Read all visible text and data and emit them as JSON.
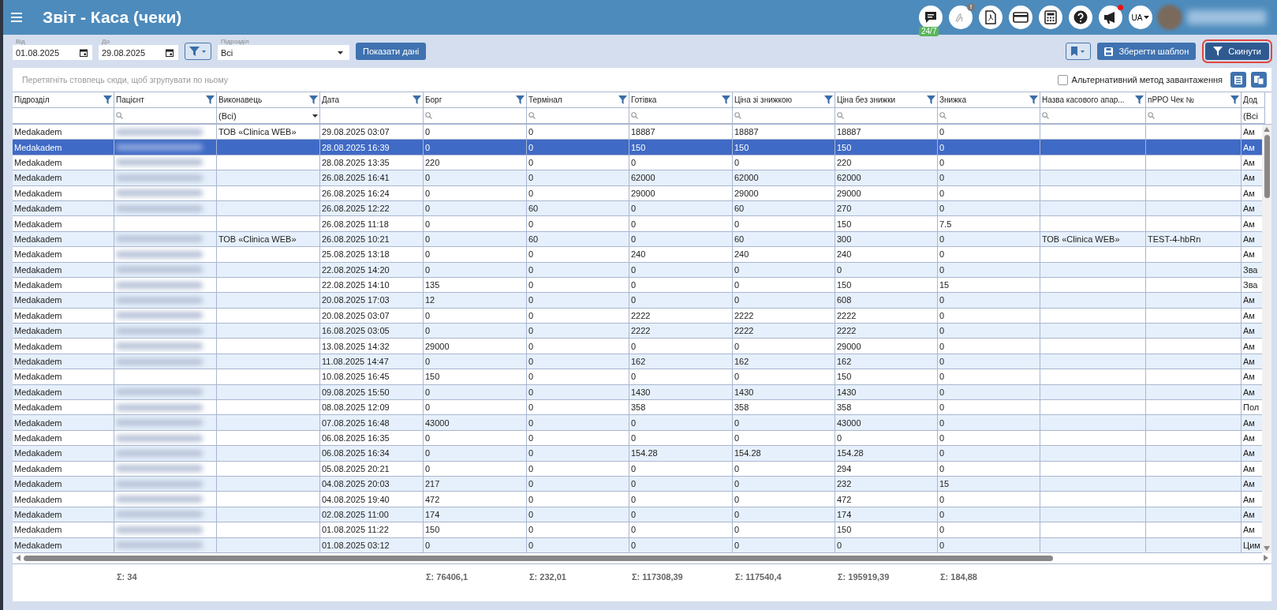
{
  "window": {
    "title": "Звіт - Каса (чеки)"
  },
  "header_icons": {
    "chat_badge": "24/7",
    "alert_badge": "!",
    "language": "UA"
  },
  "toolbar": {
    "date_from": {
      "label": "Від",
      "value": "01.08.2025"
    },
    "date_to": {
      "label": "До",
      "value": "29.08.2025"
    },
    "division": {
      "label": "Підрозділ",
      "value": "Всі"
    },
    "show_button": "Показати дані",
    "save_button": "Зберегти шаблон",
    "reset_button": "Скинути",
    "reset_highlighted": true
  },
  "group_panel": {
    "placeholder": "Перетягніть стовпець сюди, щоб згрупувати по ньому",
    "alt_load": {
      "label": "Альтернативний метод завантаження",
      "checked": false
    }
  },
  "table": {
    "columns": [
      {
        "label": "Підрозділ",
        "filter_button": true,
        "filter": {
          "kind": "none"
        }
      },
      {
        "label": "Пацієнт",
        "filter_button": true,
        "filter": {
          "kind": "search"
        }
      },
      {
        "label": "Виконавець",
        "filter_button": true,
        "filter": {
          "kind": "dropdown",
          "value": "(Всі)"
        }
      },
      {
        "label": "Дата",
        "filter_button": true,
        "filter": {
          "kind": "none"
        }
      },
      {
        "label": "Борг",
        "filter_button": true,
        "filter": {
          "kind": "search"
        }
      },
      {
        "label": "Термінал",
        "filter_button": true,
        "filter": {
          "kind": "search"
        }
      },
      {
        "label": "Готівка",
        "filter_button": true,
        "filter": {
          "kind": "search"
        }
      },
      {
        "label": "Ціна зі знижкою",
        "filter_button": true,
        "filter": {
          "kind": "search"
        }
      },
      {
        "label": "Ціна без знижки",
        "filter_button": true,
        "filter": {
          "kind": "search"
        }
      },
      {
        "label": "Знижка",
        "filter_button": true,
        "filter": {
          "kind": "search"
        }
      },
      {
        "label": "Назва касового апар...",
        "filter_button": true,
        "filter": {
          "kind": "search"
        }
      },
      {
        "label": "пРРО Чек №",
        "filter_button": true,
        "filter": {
          "kind": "search"
        }
      },
      {
        "label": "Дод",
        "filter_button": false,
        "filter": {
          "kind": "text",
          "value": "(Всі"
        }
      }
    ],
    "rows": [
      {
        "selected": false,
        "patient_blurred": true,
        "cells": [
          "Medakadem",
          null,
          "ТОВ «Clinica WEB»",
          "29.08.2025 03:07",
          "0",
          "0",
          "18887",
          "18887",
          "18887",
          "0",
          null,
          null,
          "Ам"
        ]
      },
      {
        "selected": true,
        "patient_blurred": true,
        "cells": [
          "Medakadem",
          null,
          null,
          "28.08.2025 16:39",
          "0",
          "0",
          "150",
          "150",
          "150",
          "0",
          null,
          null,
          "Ам"
        ]
      },
      {
        "selected": false,
        "patient_blurred": true,
        "cells": [
          "Medakadem",
          null,
          null,
          "28.08.2025 13:35",
          "220",
          "0",
          "0",
          "0",
          "220",
          "0",
          null,
          null,
          "Ам"
        ]
      },
      {
        "selected": false,
        "patient_blurred": true,
        "cells": [
          "Medakadem",
          null,
          null,
          "26.08.2025 16:41",
          "0",
          "0",
          "62000",
          "62000",
          "62000",
          "0",
          null,
          null,
          "Ам"
        ]
      },
      {
        "selected": false,
        "patient_blurred": true,
        "cells": [
          "Medakadem",
          null,
          null,
          "26.08.2025 16:24",
          "0",
          "0",
          "29000",
          "29000",
          "29000",
          "0",
          null,
          null,
          "Ам"
        ]
      },
      {
        "selected": false,
        "patient_blurred": true,
        "cells": [
          "Medakadem",
          null,
          null,
          "26.08.2025 12:22",
          "0",
          "60",
          "0",
          "60",
          "270",
          "0",
          null,
          null,
          "Ам"
        ]
      },
      {
        "selected": false,
        "patient_blurred": false,
        "cells": [
          "Medakadem",
          null,
          null,
          "26.08.2025 11:18",
          "0",
          "0",
          "0",
          "0",
          "150",
          "7.5",
          null,
          null,
          "Ам"
        ]
      },
      {
        "selected": false,
        "patient_blurred": true,
        "cells": [
          "Medakadem",
          null,
          "ТОВ «Clinica WEB»",
          "26.08.2025 10:21",
          "0",
          "60",
          "0",
          "60",
          "300",
          "0",
          "ТОВ «Clinica WEB»",
          "TEST-4-hbRn",
          "Ам"
        ]
      },
      {
        "selected": false,
        "patient_blurred": true,
        "cells": [
          "Medakadem",
          null,
          null,
          "25.08.2025 13:18",
          "0",
          "0",
          "240",
          "240",
          "240",
          "0",
          null,
          null,
          "Ам"
        ]
      },
      {
        "selected": false,
        "patient_blurred": true,
        "cells": [
          "Medakadem",
          null,
          null,
          "22.08.2025 14:20",
          "0",
          "0",
          "0",
          "0",
          "0",
          "0",
          null,
          null,
          "Зва"
        ]
      },
      {
        "selected": false,
        "patient_blurred": true,
        "cells": [
          "Medakadem",
          null,
          null,
          "22.08.2025 14:10",
          "135",
          "0",
          "0",
          "0",
          "150",
          "15",
          null,
          null,
          "Зва"
        ]
      },
      {
        "selected": false,
        "patient_blurred": true,
        "cells": [
          "Medakadem",
          null,
          null,
          "20.08.2025 17:03",
          "12",
          "0",
          "0",
          "0",
          "608",
          "0",
          null,
          null,
          "Ам"
        ]
      },
      {
        "selected": false,
        "patient_blurred": true,
        "cells": [
          "Medakadem",
          null,
          null,
          "20.08.2025 03:07",
          "0",
          "0",
          "2222",
          "2222",
          "2222",
          "0",
          null,
          null,
          "Ам"
        ]
      },
      {
        "selected": false,
        "patient_blurred": true,
        "cells": [
          "Medakadem",
          null,
          null,
          "16.08.2025 03:05",
          "0",
          "0",
          "2222",
          "2222",
          "2222",
          "0",
          null,
          null,
          "Ам"
        ]
      },
      {
        "selected": false,
        "patient_blurred": true,
        "cells": [
          "Medakadem",
          null,
          null,
          "13.08.2025 14:32",
          "29000",
          "0",
          "0",
          "0",
          "29000",
          "0",
          null,
          null,
          "Ам"
        ]
      },
      {
        "selected": false,
        "patient_blurred": true,
        "cells": [
          "Medakadem",
          null,
          null,
          "11.08.2025 14:47",
          "0",
          "0",
          "162",
          "162",
          "162",
          "0",
          null,
          null,
          "Ам"
        ]
      },
      {
        "selected": false,
        "patient_blurred": false,
        "cells": [
          "Medakadem",
          null,
          null,
          "10.08.2025 16:45",
          "150",
          "0",
          "0",
          "0",
          "150",
          "0",
          null,
          null,
          "Ам"
        ]
      },
      {
        "selected": false,
        "patient_blurred": true,
        "cells": [
          "Medakadem",
          null,
          null,
          "09.08.2025 15:50",
          "0",
          "0",
          "1430",
          "1430",
          "1430",
          "0",
          null,
          null,
          "Ам"
        ]
      },
      {
        "selected": false,
        "patient_blurred": true,
        "cells": [
          "Medakadem",
          null,
          null,
          "08.08.2025 12:09",
          "0",
          "0",
          "358",
          "358",
          "358",
          "0",
          null,
          null,
          "Пол"
        ]
      },
      {
        "selected": false,
        "patient_blurred": true,
        "cells": [
          "Medakadem",
          null,
          null,
          "07.08.2025 16:48",
          "43000",
          "0",
          "0",
          "0",
          "43000",
          "0",
          null,
          null,
          "Ам"
        ]
      },
      {
        "selected": false,
        "patient_blurred": true,
        "cells": [
          "Medakadem",
          null,
          null,
          "06.08.2025 16:35",
          "0",
          "0",
          "0",
          "0",
          "0",
          "0",
          null,
          null,
          "Ам"
        ]
      },
      {
        "selected": false,
        "patient_blurred": true,
        "cells": [
          "Medakadem",
          null,
          null,
          "06.08.2025 16:34",
          "0",
          "0",
          "154.28",
          "154.28",
          "154.28",
          "0",
          null,
          null,
          "Ам"
        ]
      },
      {
        "selected": false,
        "patient_blurred": true,
        "cells": [
          "Medakadem",
          null,
          null,
          "05.08.2025 20:21",
          "0",
          "0",
          "0",
          "0",
          "294",
          "0",
          null,
          null,
          "Ам"
        ]
      },
      {
        "selected": false,
        "patient_blurred": true,
        "cells": [
          "Medakadem",
          null,
          null,
          "04.08.2025 20:03",
          "217",
          "0",
          "0",
          "0",
          "232",
          "15",
          null,
          null,
          "Ам"
        ]
      },
      {
        "selected": false,
        "patient_blurred": true,
        "cells": [
          "Medakadem",
          null,
          null,
          "04.08.2025 19:40",
          "472",
          "0",
          "0",
          "0",
          "472",
          "0",
          null,
          null,
          "Ам"
        ]
      },
      {
        "selected": false,
        "patient_blurred": true,
        "cells": [
          "Medakadem",
          null,
          null,
          "02.08.2025 11:00",
          "174",
          "0",
          "0",
          "0",
          "174",
          "0",
          null,
          null,
          "Ам"
        ]
      },
      {
        "selected": false,
        "patient_blurred": true,
        "cells": [
          "Medakadem",
          null,
          null,
          "01.08.2025 11:22",
          "150",
          "0",
          "0",
          "0",
          "150",
          "0",
          null,
          null,
          "Ам"
        ]
      },
      {
        "selected": false,
        "patient_blurred": true,
        "cells": [
          "Medakadem",
          null,
          null,
          "01.08.2025 03:12",
          "0",
          "0",
          "0",
          "0",
          "0",
          "0",
          null,
          null,
          "Цим"
        ]
      }
    ]
  },
  "summary": [
    "Σ: 34",
    "Σ: 76406,1",
    "Σ: 232,01",
    "Σ: 117308,39",
    "Σ: 117540,4",
    "Σ: 195919,39",
    "Σ: 184,88"
  ]
}
